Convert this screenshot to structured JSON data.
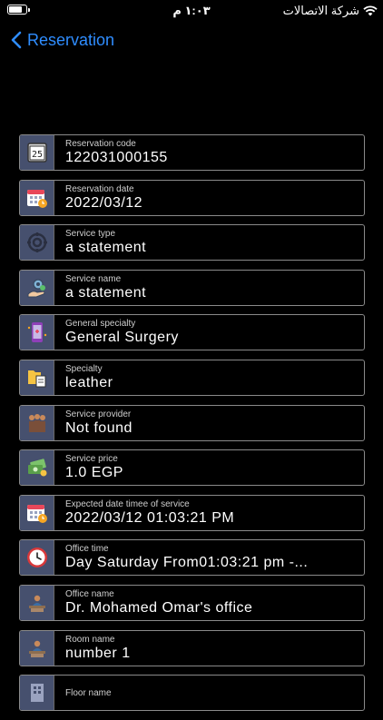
{
  "status_bar": {
    "time": "١:٠٣ م",
    "carrier": "شركة الاتصالات"
  },
  "nav": {
    "back_label": "Reservation"
  },
  "fields": [
    {
      "icon": "calendar-25-icon",
      "label": "Reservation code",
      "value": "122031000155"
    },
    {
      "icon": "calendar-clock-icon",
      "label": "Reservation date",
      "value": "2022/03/12"
    },
    {
      "icon": "service-gear-icon",
      "label": "Service type",
      "value": "a statement"
    },
    {
      "icon": "hand-gear-icon",
      "label": "Service name",
      "value": "a statement"
    },
    {
      "icon": "phone-medical-icon",
      "label": "General specialty",
      "value": "General Surgery"
    },
    {
      "icon": "folder-document-icon",
      "label": "Specialty",
      "value": "leather"
    },
    {
      "icon": "people-group-icon",
      "label": "Service provider",
      "value": "Not found"
    },
    {
      "icon": "money-icon",
      "label": "Service price",
      "value": "1.0  EGP"
    },
    {
      "icon": "calendar-clock-icon",
      "label": "Expected date timee of service",
      "value": "2022/03/12 01:03:21 PM"
    },
    {
      "icon": "clock-icon",
      "label": "Office time",
      "value": "Day Saturday From01:03:21 pm -..."
    },
    {
      "icon": "office-desk-icon",
      "label": "Office name",
      "value": "Dr. Mohamed Omar's office"
    },
    {
      "icon": "office-desk-icon",
      "label": "Room name",
      "value": "number 1"
    },
    {
      "icon": "building-icon",
      "label": "Floor name",
      "value": ""
    }
  ]
}
